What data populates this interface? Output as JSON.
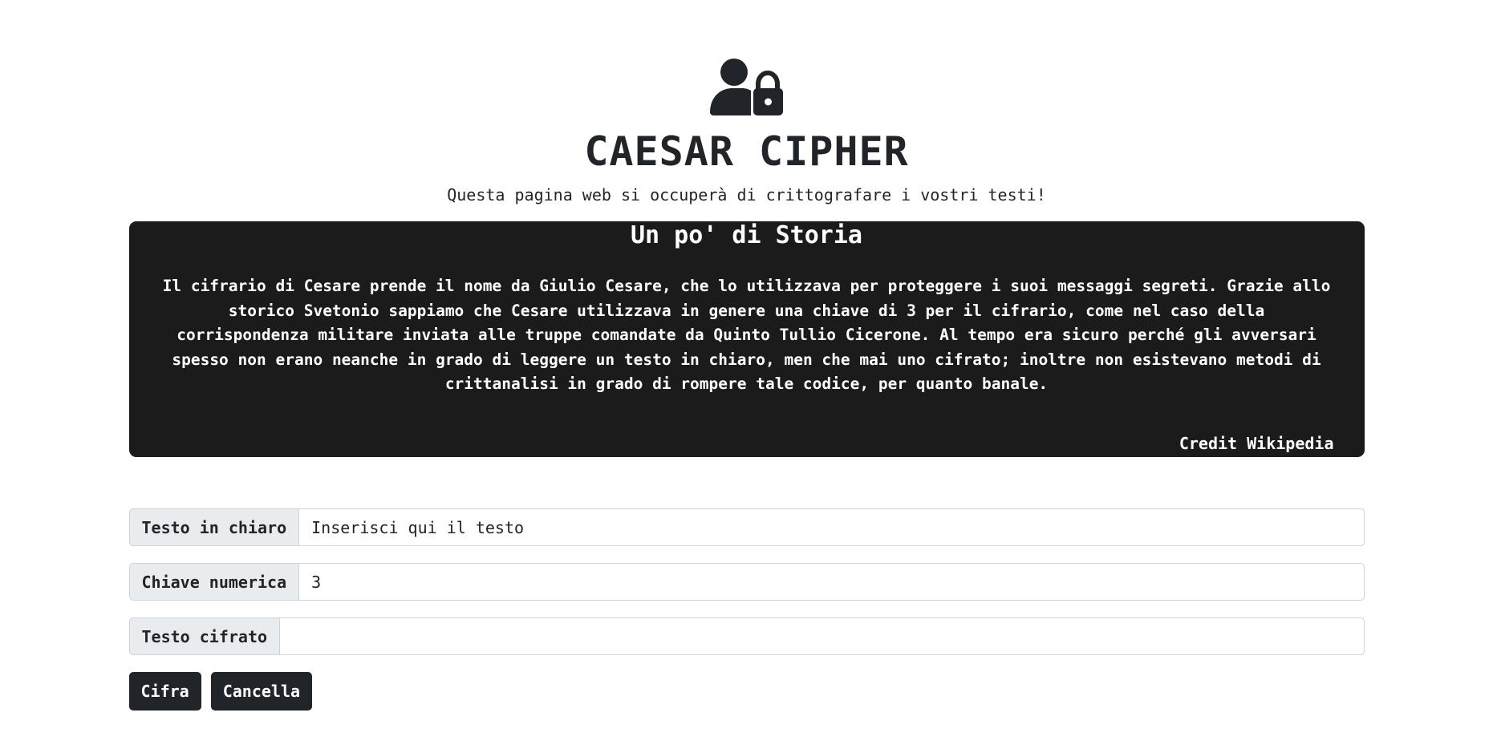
{
  "header": {
    "logo_icon": "user-lock-icon",
    "title": "CAESAR CIPHER",
    "subtitle": "Questa pagina web si occuperà di crittografare i vostri testi!"
  },
  "history": {
    "title": "Un po' di Storia",
    "text": "Il cifrario di Cesare prende il nome da Giulio Cesare, che lo utilizzava per proteggere i suoi messaggi segreti. Grazie allo storico Svetonio sappiamo che Cesare utilizzava in genere una chiave di 3 per il cifrario, come nel caso della corrispondenza militare inviata alle truppe comandate da Quinto Tullio Cicerone. Al tempo era sicuro perché gli avversari spesso non erano neanche in grado di leggere un testo in chiaro, men che mai uno cifrato; inoltre non esistevano metodi di crittanalisi in grado di rompere tale codice, per quanto banale.",
    "credit": "Credit Wikipedia"
  },
  "form": {
    "plaintext": {
      "label": "Testo in chiaro",
      "value": "",
      "placeholder": "Inserisci qui il testo"
    },
    "key": {
      "label": "Chiave numerica",
      "value": "3",
      "placeholder": ""
    },
    "ciphertext": {
      "label": "Testo cifrato",
      "value": "",
      "placeholder": ""
    }
  },
  "buttons": {
    "encrypt_label": "Cifra",
    "clear_label": "Cancella"
  },
  "colors": {
    "dark": "#212529",
    "panel": "#1b1b1b",
    "label_bg": "#e9ecef",
    "border": "#ced4da"
  }
}
